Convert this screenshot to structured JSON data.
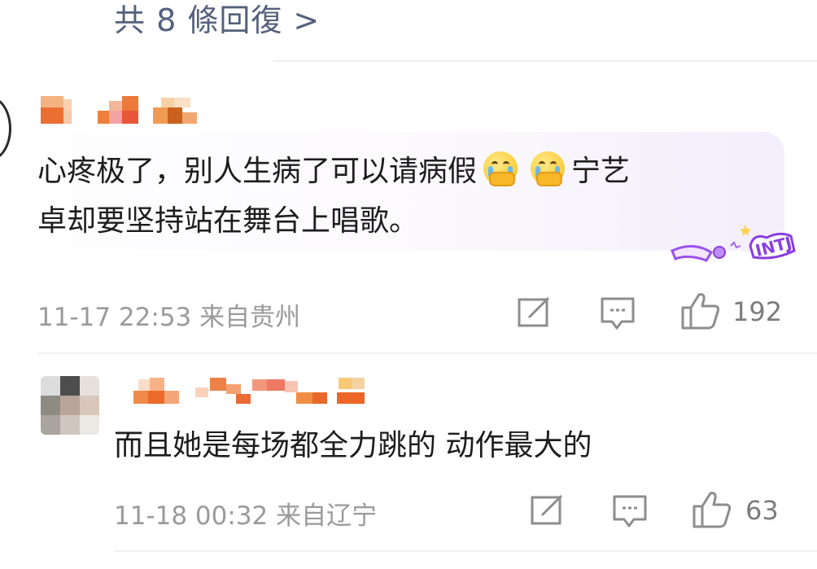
{
  "thread": {
    "reply_link": "共 8 條回復 >"
  },
  "comments": [
    {
      "text_line1_a": "心疼极了，别人生病了可以请病假",
      "text_line1_b": "宁艺",
      "text_line2": "卓却要坚持站在舞台上唱歌。",
      "emoji": "crying-face-covering-mouth",
      "sticker_text": "INTJ",
      "timestamp": "11-17 22:53",
      "location": "来自贵州",
      "likes": "192"
    },
    {
      "text": "而且她是每场都全力跳的  动作最大的",
      "timestamp": "11-18 00:32",
      "location": "来自辽宁",
      "likes": "63"
    }
  ],
  "icons": {
    "repost": "repost-icon",
    "comment": "comment-icon",
    "like": "thumbs-up-icon"
  },
  "colors": {
    "reply_link": "#54617d",
    "text": "#1d1d1d",
    "meta": "#9a9a9a",
    "bubble_tint": "#f3eefb"
  }
}
